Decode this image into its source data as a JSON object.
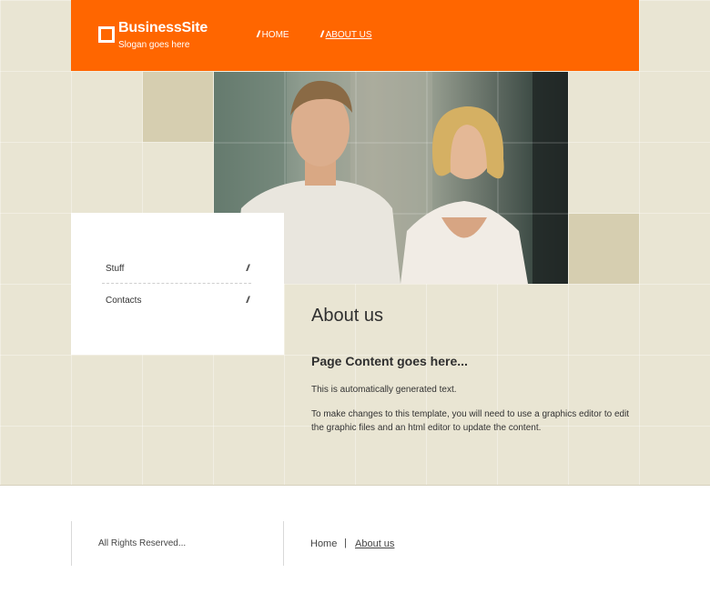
{
  "header": {
    "brand": "BusinessSite",
    "slogan": "Slogan goes here",
    "nav": [
      {
        "label": "HOME",
        "active": false
      },
      {
        "label": "ABOUT US",
        "active": true
      }
    ],
    "accent_color": "#ff6600"
  },
  "sidebar": {
    "items": [
      {
        "label": "Stuff"
      },
      {
        "label": "Contacts"
      }
    ]
  },
  "content": {
    "title": "About us",
    "subtitle": "Page Content goes here...",
    "paragraph1": "This is automatically generated text.",
    "paragraph2": "To make changes to this template, you will need to use a graphics editor to edit the graphic files and an html editor to update the content."
  },
  "footer": {
    "rights": "All Rights Reserved...",
    "links": [
      {
        "label": "Home",
        "active": false
      },
      {
        "label": "About us",
        "active": true
      }
    ],
    "separator": "|"
  }
}
